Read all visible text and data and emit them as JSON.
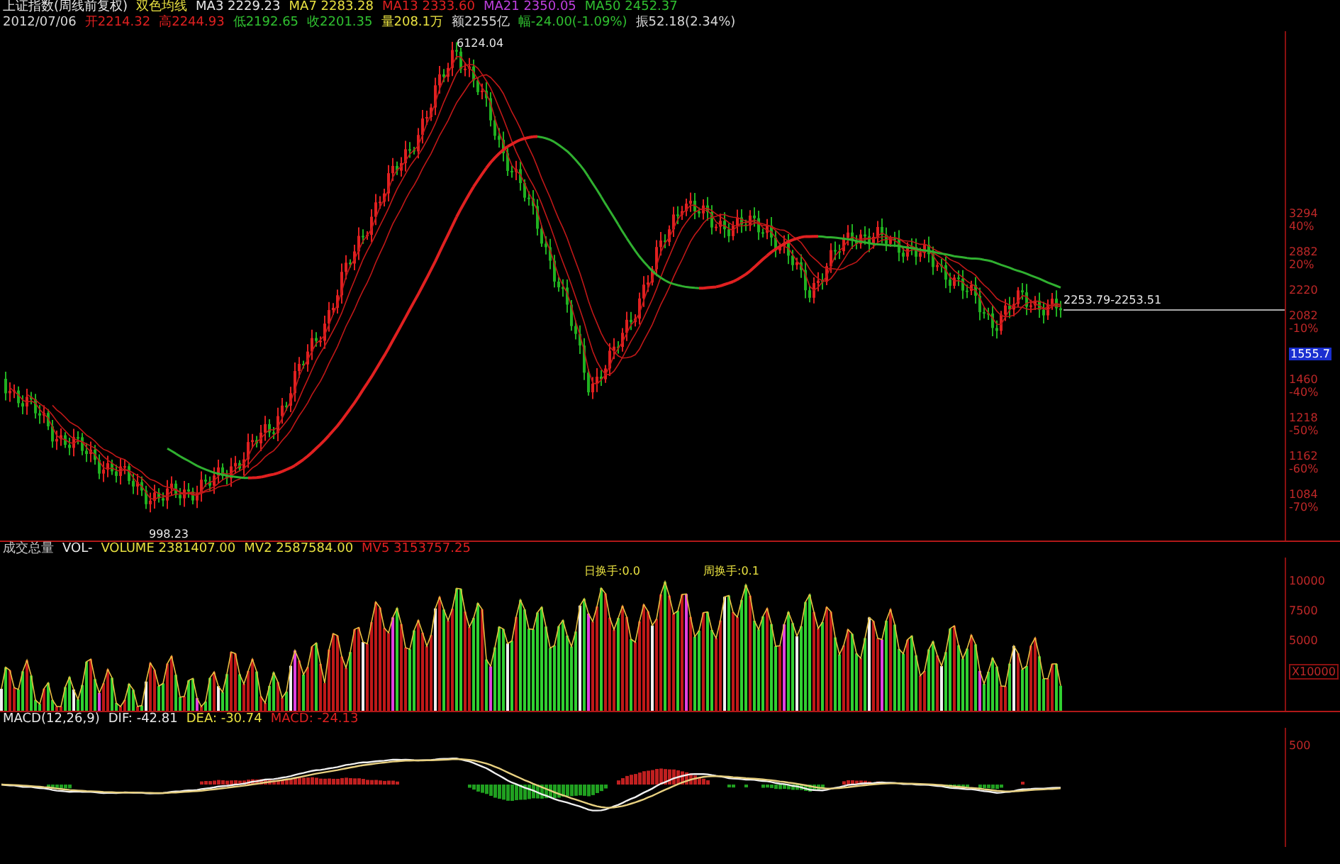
{
  "chart_header": {
    "title": "上证指数(周线前复权)",
    "indicator": "双色均线",
    "ma": [
      {
        "text": "MA3 2229.23",
        "color": "#e8e8e8"
      },
      {
        "text": "MA7 2283.28",
        "color": "#e8e040"
      },
      {
        "text": "MA13 2333.60",
        "color": "#e02020"
      },
      {
        "text": "MA21 2350.05",
        "color": "#c040e0"
      },
      {
        "text": "MA50 2452.37",
        "color": "#30c030"
      }
    ]
  },
  "quote": [
    {
      "text": "2012/07/06",
      "color": "#d8d8d8"
    },
    {
      "text": "开2214.32",
      "color": "#e02020"
    },
    {
      "text": "高2244.93",
      "color": "#e02020"
    },
    {
      "text": "低2192.65",
      "color": "#30c030"
    },
    {
      "text": "收2201.35",
      "color": "#30c030"
    },
    {
      "text": "量208.1万",
      "color": "#e8e040"
    },
    {
      "text": "额2255亿",
      "color": "#d8d8d8"
    },
    {
      "text": "幅-24.00(-1.09%)",
      "color": "#30c030"
    },
    {
      "text": "振52.18(2.34%)",
      "color": "#d8d8d8"
    }
  ],
  "price_annotations": [
    {
      "text": "6124.04"
    },
    {
      "text": "998.23"
    },
    {
      "text": "2253.79-2253.51"
    }
  ],
  "price_axis": [
    {
      "kind": "price",
      "text": "3294",
      "sub": "40%"
    },
    {
      "kind": "price",
      "text": "2882",
      "sub": "20%"
    },
    {
      "kind": "price",
      "text": "2220"
    },
    {
      "kind": "price",
      "text": "2082",
      "sub": "-10%"
    },
    {
      "kind": "current",
      "text": "1555.7"
    },
    {
      "kind": "price",
      "text": "1460",
      "sub": "-40%"
    },
    {
      "kind": "price",
      "text": "1218",
      "sub": "-50%"
    },
    {
      "kind": "price",
      "text": "1162",
      "sub": "-60%"
    },
    {
      "kind": "price",
      "text": "1084",
      "sub": "-70%"
    }
  ],
  "volume_header": [
    {
      "text": "成交总量",
      "color": "#c8c8c8"
    },
    {
      "text": "VOL-",
      "color": "#e8e8e8"
    },
    {
      "text": "VOLUME 2381407.00",
      "color": "#e8e040"
    },
    {
      "text": "MV2 2587584.00",
      "color": "#e8e040"
    },
    {
      "text": "MV5 3153757.25",
      "color": "#e02020"
    }
  ],
  "volume_annotations": [
    {
      "text": "日换手:0.0"
    },
    {
      "text": "周换手:0.1"
    }
  ],
  "volume_axis": [
    {
      "kind": "value",
      "text": "10000"
    },
    {
      "kind": "value",
      "text": "7500"
    },
    {
      "kind": "value",
      "text": "5000"
    },
    {
      "kind": "unit",
      "text": "X10000"
    }
  ],
  "macd_header": [
    {
      "text": "MACD(12,26,9)",
      "color": "#e8e8e8"
    },
    {
      "text": "DIF: -42.81",
      "color": "#e8e8e8"
    },
    {
      "text": "DEA: -30.74",
      "color": "#e8e040"
    },
    {
      "text": "MACD: -24.13",
      "color": "#e02020"
    }
  ],
  "macd_axis": [
    {
      "kind": "value",
      "text": "500"
    }
  ]
}
